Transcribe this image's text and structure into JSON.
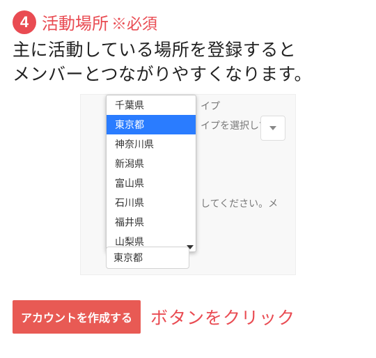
{
  "step": {
    "number": "4",
    "title": "活動場所",
    "required_marker": "※必須"
  },
  "description_line1": "主に活動している場所を登録すると",
  "description_line2": "メンバーとつながりやすくなります。",
  "dropdown": {
    "options": [
      "千葉県",
      "東京都",
      "神奈川県",
      "新潟県",
      "富山県",
      "石川県",
      "福井県",
      "山梨県"
    ],
    "selected_index": 1
  },
  "field_value": "東京都",
  "behind": {
    "label_fragment": "イプ",
    "placeholder_fragment": "イプを選択してく",
    "hint_fragment": "してください。メ"
  },
  "cta": {
    "button_label": "アカウントを作成する",
    "trailing_text": "ボタンをクリック"
  }
}
